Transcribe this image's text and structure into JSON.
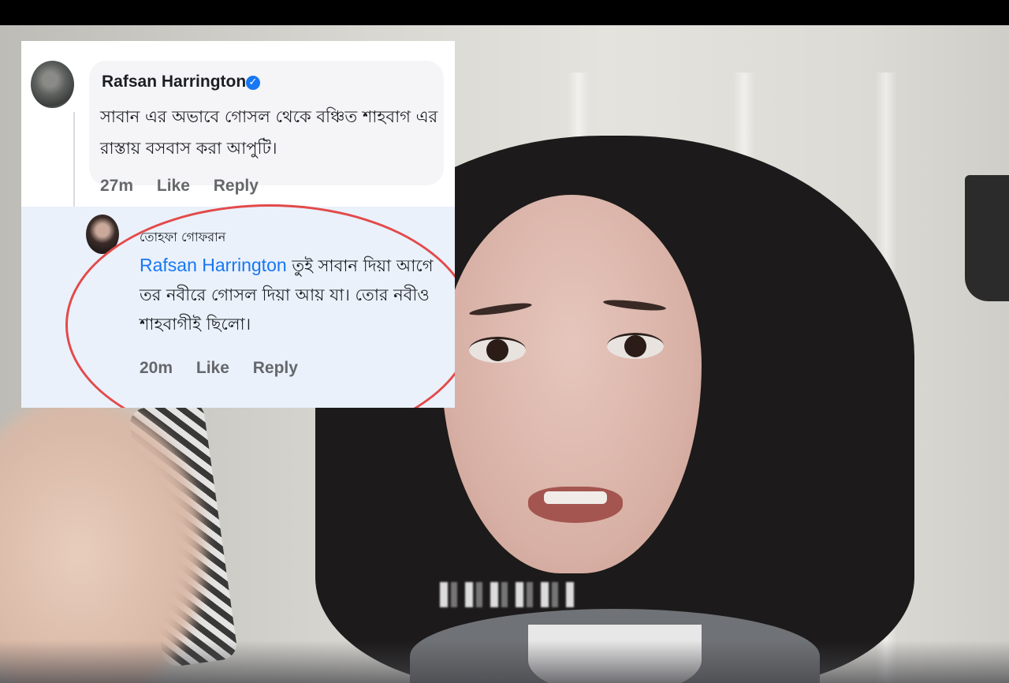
{
  "comment": {
    "author": "Rafsan Harrington",
    "text": "সাবান এর অভাবে গোসল থেকে বঞ্চিত শাহবাগ এর রাস্তায় বসবাস করা আপুটি।",
    "time": "27m",
    "like": "Like",
    "reply": "Reply"
  },
  "reply": {
    "author": "তোহফা গোফরান",
    "mention": "Rafsan Harrington",
    "text": " তুই সাবান দিয়া আগে তর নবীরে গোসল দিয়া আয় যা। তোর নবীও শাহবাগীই ছিলো।",
    "time": "20m",
    "like": "Like",
    "reply": "Reply"
  },
  "icons": {
    "verified": "verified-badge-icon"
  },
  "colors": {
    "link": "#1877f2",
    "highlight": "#e34a4a"
  }
}
